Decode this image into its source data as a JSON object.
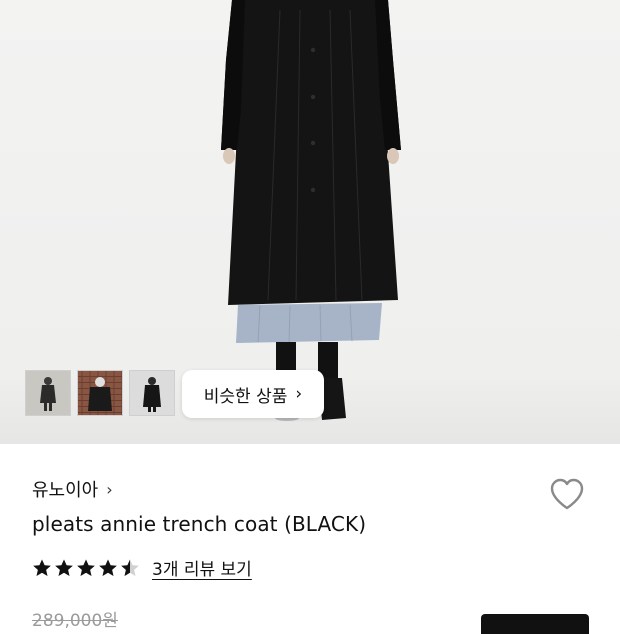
{
  "gallery": {
    "thumbnail_count": 3,
    "similar_button_label": "비슷한 상품"
  },
  "product": {
    "brand": "유노이아",
    "name": "pleats annie trench coat (BLACK)",
    "rating": 4.5,
    "reviews_link": "3개 리뷰 보기",
    "original_price": "289,000원"
  },
  "icons": {
    "brand_chevron": "chevron-right-icon",
    "similar_chevron": "chevron-right-icon",
    "wishlist": "heart-outline-icon",
    "rating": "star-icon"
  },
  "colors": {
    "text": "#111111",
    "muted": "#9a9a9a",
    "button_dark": "#111111"
  }
}
